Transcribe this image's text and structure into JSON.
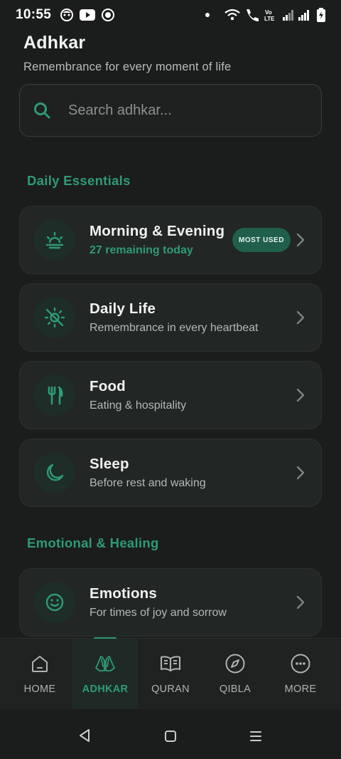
{
  "status_bar": {
    "time": "10:55",
    "left_icons": [
      "face-icon",
      "youtube-icon",
      "record-icon"
    ],
    "right_icons": [
      "dot-icon",
      "wifi-icon",
      "call-icon",
      "volte-icon",
      "signal-icon",
      "signal-icon",
      "battery-icon"
    ]
  },
  "header": {
    "title": "Adhkar",
    "subtitle": "Remembrance for every moment of life"
  },
  "search": {
    "placeholder": "Search adhkar..."
  },
  "sections": [
    {
      "title": "Daily Essentials",
      "cards": [
        {
          "icon": "sunrise-icon",
          "title": "Morning & Evening",
          "subtitle": "27 remaining today",
          "badge": "MOST USED"
        },
        {
          "icon": "sun-off-icon",
          "title": "Daily Life",
          "subtitle": "Remembrance in every heartbeat"
        },
        {
          "icon": "utensils-icon",
          "title": "Food",
          "subtitle": "Eating & hospitality"
        },
        {
          "icon": "moon-icon",
          "title": "Sleep",
          "subtitle": "Before rest and waking"
        }
      ]
    },
    {
      "title": "Emotional & Healing",
      "cards": [
        {
          "icon": "smile-icon",
          "title": "Emotions",
          "subtitle": "For times of joy and sorrow"
        }
      ]
    }
  ],
  "bottom_nav": {
    "items": [
      {
        "label": "HOME",
        "icon": "home-icon"
      },
      {
        "label": "ADHKAR",
        "icon": "praying-hands-icon",
        "active": true
      },
      {
        "label": "QURAN",
        "icon": "book-icon"
      },
      {
        "label": "QIBLA",
        "icon": "compass-icon"
      },
      {
        "label": "MORE",
        "icon": "more-icon"
      }
    ]
  },
  "colors": {
    "background": "#1b1d1c",
    "accent": "#2f9a78",
    "card": "#222624",
    "badge": "#1f5f4c"
  }
}
